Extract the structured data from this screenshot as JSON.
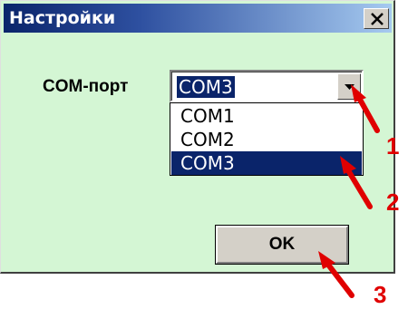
{
  "window": {
    "title": "Настройки"
  },
  "form": {
    "com_label": "COM-порт",
    "com_value": "COM3",
    "options": [
      "COM1",
      "COM2",
      "COM3"
    ],
    "selected_option": "COM3"
  },
  "buttons": {
    "ok_label": "OK"
  },
  "annotations": {
    "n1": "1",
    "n2": "2",
    "n3": "3"
  },
  "colors": {
    "dialog_background": "#d4f6d4",
    "selection": "#0a246a",
    "annotation_red": "#e00000"
  },
  "icons": {
    "close": "close-icon",
    "dropdown": "triangle-down-icon",
    "pointer": "red-arrow-icon"
  }
}
